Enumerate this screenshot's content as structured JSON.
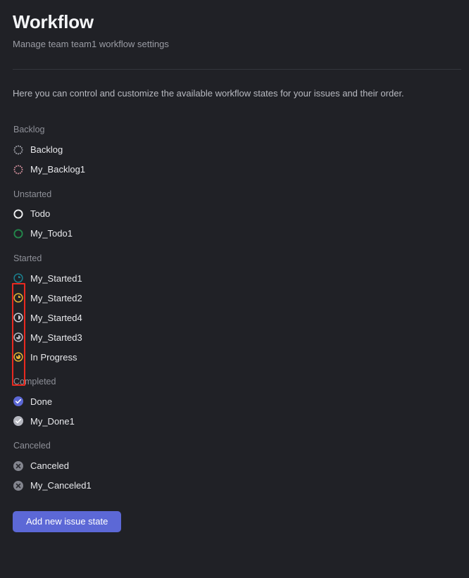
{
  "header": {
    "title": "Workflow",
    "subtitle": "Manage team team1 workflow settings"
  },
  "intro": "Here you can control and customize the available workflow states for your issues and their order.",
  "groups": [
    {
      "label": "Backlog",
      "states": [
        {
          "name": "Backlog",
          "icon": "dotted-circle-icon",
          "color": "#9fa1a9"
        },
        {
          "name": "My_Backlog1",
          "icon": "dotted-circle-icon",
          "color": "#c98a96"
        }
      ]
    },
    {
      "label": "Unstarted",
      "states": [
        {
          "name": "Todo",
          "icon": "circle-outline-icon",
          "color": "#f1f2f4"
        },
        {
          "name": "My_Todo1",
          "icon": "circle-outline-icon",
          "color": "#23874b"
        }
      ]
    },
    {
      "label": "Started",
      "states": [
        {
          "name": "My_Started1",
          "icon": "progress-pie-icon",
          "color": "#1b7f8e",
          "progress": 25
        },
        {
          "name": "My_Started2",
          "icon": "progress-pie-icon",
          "color": "#e3b334",
          "progress": 25
        },
        {
          "name": "My_Started4",
          "icon": "progress-pie-icon",
          "color": "#c8cad0",
          "progress": 50
        },
        {
          "name": "My_Started3",
          "icon": "progress-pie-icon",
          "color": "#b5b7bf",
          "progress": 75
        },
        {
          "name": "In Progress",
          "icon": "progress-pie-icon",
          "color": "#e3b334",
          "progress": 85
        }
      ]
    },
    {
      "label": "Completed",
      "states": [
        {
          "name": "Done",
          "icon": "check-circle-icon",
          "color": "#5c68d6"
        },
        {
          "name": "My_Done1",
          "icon": "check-circle-icon",
          "color": "#b5b7bf"
        }
      ]
    },
    {
      "label": "Canceled",
      "states": [
        {
          "name": "Canceled",
          "icon": "x-circle-icon",
          "color": "#83858e"
        },
        {
          "name": "My_Canceled1",
          "icon": "x-circle-icon",
          "color": "#83858e"
        }
      ]
    }
  ],
  "footer": {
    "add_state_label": "Add new issue state"
  },
  "annotation": {
    "color": "#e8291f",
    "target": "started-state-icons"
  }
}
